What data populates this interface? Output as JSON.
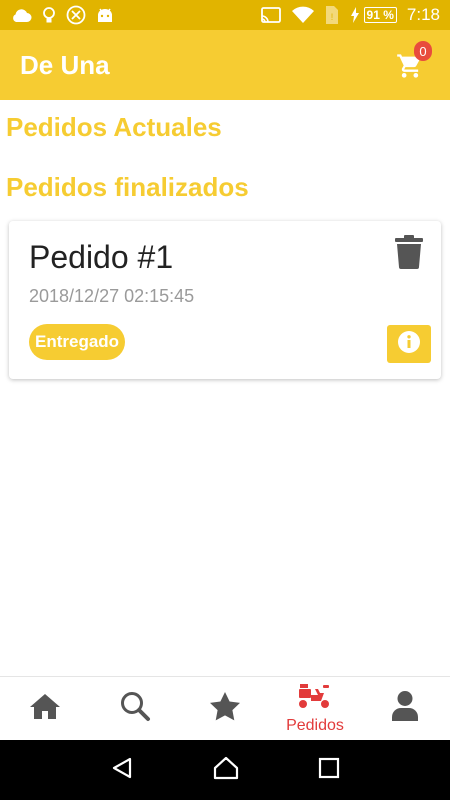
{
  "status_bar": {
    "battery": "91 %",
    "time": "7:18"
  },
  "app_bar": {
    "title": "De Una",
    "cart_count": "0"
  },
  "sections": {
    "current": "Pedidos Actuales",
    "finished": "Pedidos finalizados"
  },
  "order": {
    "title": "Pedido #1",
    "date": "2018/12/27 02:15:45",
    "status": "Entregado"
  },
  "bottom_nav": {
    "orders_label": "Pedidos"
  },
  "colors": {
    "primary": "#f6cc32",
    "status_bar": "#e1b400",
    "accent_red": "#e23b3b",
    "icon_grey": "#555555",
    "text_dark": "#222222"
  }
}
